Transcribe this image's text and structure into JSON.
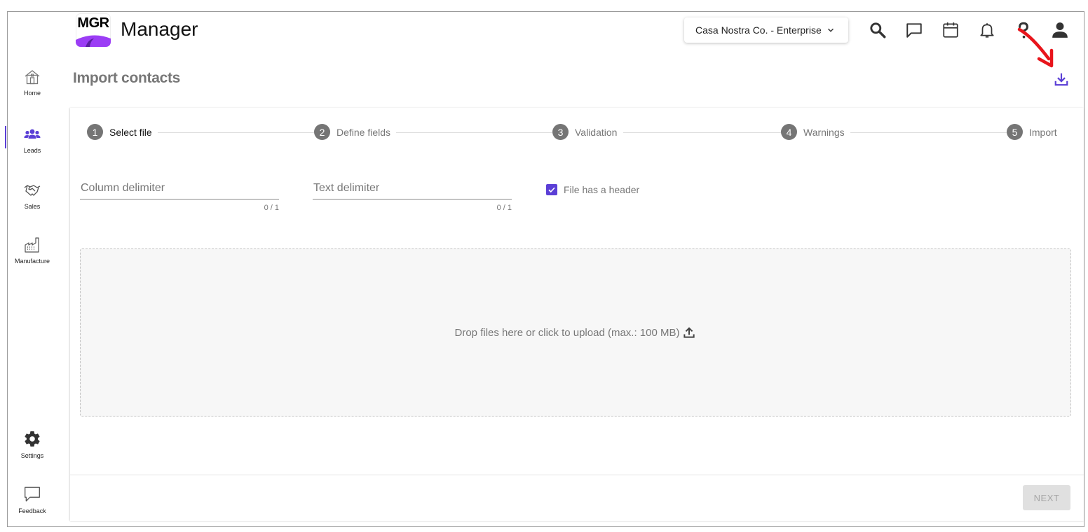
{
  "app": {
    "logo_text": "MGR",
    "title": "Manager"
  },
  "header": {
    "org_selector": "Casa Nostra Co. - Enterprise",
    "icons": [
      "search-icon",
      "chat-icon",
      "calendar-icon",
      "bell-icon",
      "help-icon",
      "user-icon"
    ]
  },
  "sidebar": {
    "items": [
      {
        "label": "Home",
        "icon": "home-icon"
      },
      {
        "label": "Leads",
        "icon": "people-icon",
        "active": true
      },
      {
        "label": "Sales",
        "icon": "handshake-icon"
      },
      {
        "label": "Manufacture",
        "icon": "factory-icon"
      }
    ],
    "bottom": [
      {
        "label": "Settings",
        "icon": "gear-icon"
      },
      {
        "label": "Feedback",
        "icon": "feedback-icon"
      }
    ]
  },
  "page": {
    "title": "Import contacts"
  },
  "stepper": {
    "steps": [
      {
        "num": "1",
        "label": "Select file"
      },
      {
        "num": "2",
        "label": "Define fields"
      },
      {
        "num": "3",
        "label": "Validation"
      },
      {
        "num": "4",
        "label": "Warnings"
      },
      {
        "num": "5",
        "label": "Import"
      }
    ]
  },
  "form": {
    "column_delimiter": {
      "placeholder": "Column delimiter",
      "value": "",
      "counter": "0 / 1"
    },
    "text_delimiter": {
      "placeholder": "Text delimiter",
      "value": "",
      "counter": "0 / 1"
    },
    "has_header": {
      "label": "File has a header",
      "checked": true
    }
  },
  "dropzone": {
    "text": "Drop files here or click to upload (max.: 100 MB)"
  },
  "footer": {
    "next_label": "NEXT"
  },
  "colors": {
    "accent": "#5b3fd6",
    "annotation_arrow": "#e8141b",
    "logo_purple": "#9b3df5"
  }
}
